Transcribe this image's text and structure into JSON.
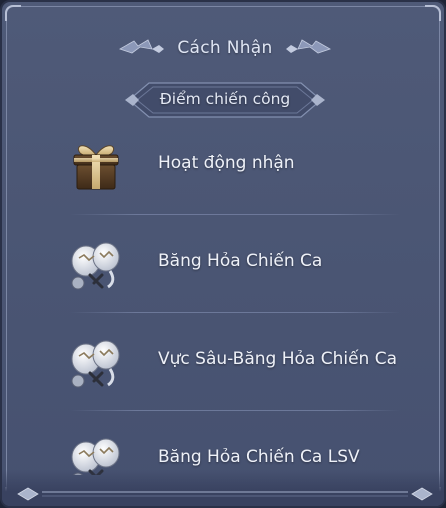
{
  "header": {
    "title": "Cách Nhận",
    "subtitle": "Điểm chiến công"
  },
  "sources": [
    {
      "label": "Hoạt động nhận",
      "icon": "gift-box-icon"
    },
    {
      "label": "Băng Hỏa Chiến Ca",
      "icon": "battle-crest-icon"
    },
    {
      "label": "Vực Sâu-Băng Hỏa Chiến Ca",
      "icon": "battle-crest-icon"
    },
    {
      "label": "Băng Hỏa Chiến Ca LSV",
      "icon": "battle-crest-icon"
    }
  ],
  "colors": {
    "panel_bg": "#4f5a78",
    "border": "#2a3148",
    "text": "#eef1f8",
    "accent_line": "#b8c0d6"
  }
}
